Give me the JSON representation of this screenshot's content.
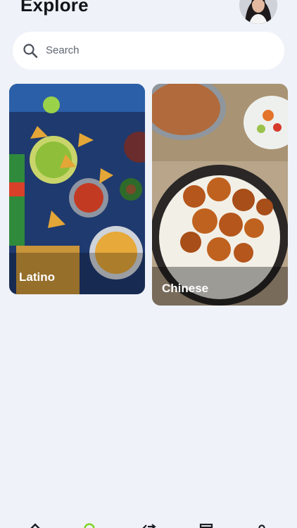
{
  "header": {
    "title": "Explore",
    "avatar_icon": "user-avatar-icon"
  },
  "search": {
    "placeholder": "Search",
    "icon": "search-icon"
  },
  "categories": [
    {
      "label": "Latino",
      "image": "latino-food-photo"
    },
    {
      "label": "Chinese",
      "image": "chinese-food-photo"
    }
  ],
  "bottom_nav": {
    "items": [
      {
        "icon": "home-icon",
        "active": false
      },
      {
        "icon": "search-icon",
        "active": true
      },
      {
        "icon": "shuffle-icon",
        "active": false
      },
      {
        "icon": "calendar-icon",
        "active": false
      },
      {
        "icon": "profile-icon",
        "active": false
      }
    ],
    "active_color": "#7ed321"
  },
  "colors": {
    "background": "#eff2f8",
    "text": "#111418",
    "placeholder": "#5f6570"
  }
}
